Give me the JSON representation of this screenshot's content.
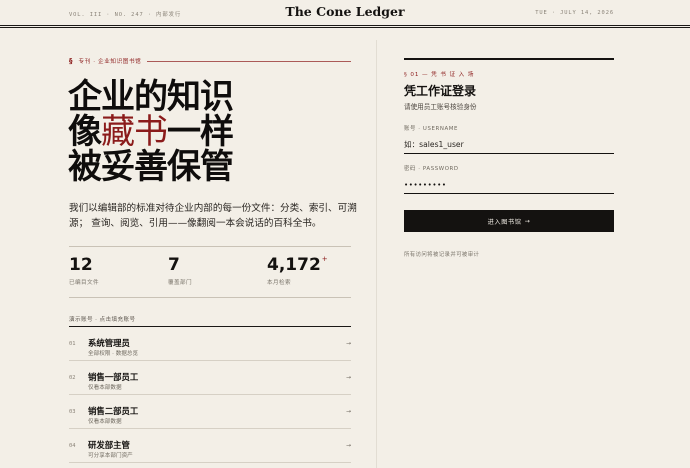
{
  "masthead": {
    "left": "VOL. III · NO. 247 · 内部发行",
    "title": "The Cone Ledger",
    "right": "TUE · JULY 14, 2026"
  },
  "intro_section": {
    "section_mark": "§",
    "kicker": "专刊 · 企业知识图书馆",
    "headline_line1": "企业的知识",
    "headline_line2_pre": "像",
    "headline_line2_accent": "藏书",
    "headline_line2_post": "一样",
    "headline_line3": "被妥善保管",
    "description": "我们以编辑部的标准对待企业内部的每一份文件：分类、索引、可溯源； 查询、阅览、引用——像翻阅一本会说话的百科全书。"
  },
  "stats": [
    {
      "value": "12",
      "suffix": "",
      "label": "已编目文件"
    },
    {
      "value": "7",
      "suffix": "",
      "label": "覆盖部门"
    },
    {
      "value": "4,172",
      "suffix": "+",
      "label": "本月检索"
    }
  ],
  "demo_accounts": {
    "label": "演示账号 · 点击填充账号",
    "items": [
      {
        "index": "01",
        "name": "系统管理员",
        "desc": "全部权限 · 数据总览",
        "arrow": "→"
      },
      {
        "index": "02",
        "name": "销售一部员工",
        "desc": "仅看本部数据",
        "arrow": "→"
      },
      {
        "index": "03",
        "name": "销售二部员工",
        "desc": "仅看本部数据",
        "arrow": "→"
      },
      {
        "index": "04",
        "name": "研发部主管",
        "desc": "可分享本部门资产",
        "arrow": "→"
      }
    ]
  },
  "login": {
    "kicker": "§ 01 — 凭 书 证 入 场",
    "title": "凭工作证登录",
    "subtitle": "请使用员工账号核验身份",
    "username_label": "账号 · USERNAME",
    "username_placeholder": "如：sales1_user",
    "password_label": "密码 · PASSWORD",
    "password_value": "•••••••••",
    "submit_label": "进入图书馆",
    "submit_arrow": "→",
    "note": "所有访问将被记录并可被审计"
  }
}
